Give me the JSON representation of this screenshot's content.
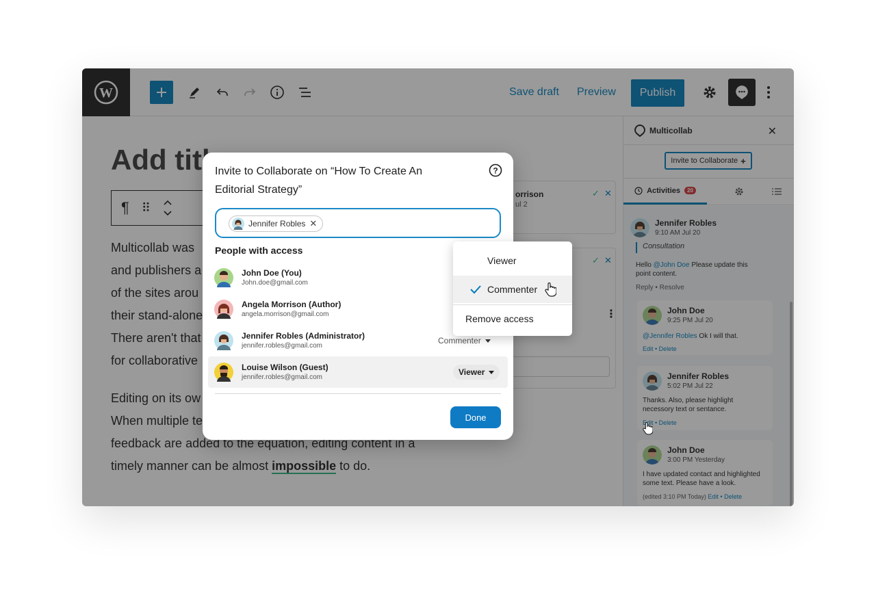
{
  "toolbar": {
    "save_draft": "Save draft",
    "preview": "Preview",
    "publish": "Publish",
    "icons": [
      "wordpress-icon",
      "plus-icon",
      "pencil-icon",
      "undo-icon",
      "redo-icon",
      "info-icon",
      "list-view-icon",
      "gear-icon",
      "multicollab-icon",
      "more-vertical-icon"
    ]
  },
  "editor": {
    "title_placeholder": "Add titl",
    "block_toolbar_icons": [
      "paragraph-icon",
      "drag-handle-icon",
      "move-up-down-icon"
    ],
    "paragraph_1": [
      "Multicollab was",
      "and publishers a",
      "of the sites arou",
      "their stand-alone",
      "There aren't that",
      "for collaborative"
    ],
    "paragraph_2_lines": [
      "Editing on its ow",
      "When multiple te",
      "feedback are added to the equation, editing content in a"
    ],
    "paragraph_2_last_prefix": "timely manner can be almost ",
    "paragraph_2_highlight": "impossible",
    "paragraph_2_last_suffix": " to do.",
    "bg_card_1_name": "orrison",
    "bg_card_1_date": "ul 2"
  },
  "sidebar": {
    "title": "Multicollab",
    "invite_button": "Invite to Collaborate",
    "tab_activities": "Activities",
    "activities_count": "20",
    "main_comment": {
      "name": "Jennifer Robles",
      "time": "9:10 AM Jul 20",
      "quote": "Consultation",
      "text_prefix": "Hello ",
      "mention": "@John Doe",
      "text_suffix": " Please update this point content.",
      "reply": "Reply",
      "resolve": "Resolve"
    },
    "replies": [
      {
        "name": "John Doe",
        "time": "9:25 PM Jul 20",
        "mention": "@Jennifer Robles",
        "text": " Ok I will that.",
        "links": "Edit • Delete"
      },
      {
        "name": "Jennifer Robles",
        "time": "5:02 PM Jul 22",
        "mention": "",
        "text": "Thanks. Also, please highlight necessory text or sentance.",
        "links": "Edit • Delete"
      },
      {
        "name": "John Doe",
        "time": "3:00 PM Yesterday",
        "mention": "",
        "text": "I have updated contact and highlighted some text. Please have a look.",
        "edited": "(edited 3:10 PM Today)",
        "links": "Edit • Delete"
      }
    ]
  },
  "modal": {
    "title": "Invite to Collaborate on “How To Create An Editorial Strategy”",
    "chip_name": "Jennifer Robles",
    "section_label": "People with access",
    "people": [
      {
        "name": "John Doe (You)",
        "email": "John.doe@gmail.com",
        "role": ""
      },
      {
        "name": "Angela Morrison (Author)",
        "email": "angela.morrison@gmail.com",
        "role": ""
      },
      {
        "name": "Jennifer Robles (Administrator)",
        "email": "jennifer.robles@gmail.com",
        "role": "Commenter"
      },
      {
        "name": "Louise Wilson (Guest)",
        "email": "jennifer.robles@gmail.com",
        "role": "Viewer"
      }
    ],
    "done": "Done"
  },
  "dropdown": {
    "options": [
      "Viewer",
      "Commenter"
    ],
    "selected": "Commenter",
    "remove": "Remove access"
  },
  "colors": {
    "accent": "#007cba",
    "badge": "#d63638",
    "highlight_underline": "#2fb380"
  }
}
